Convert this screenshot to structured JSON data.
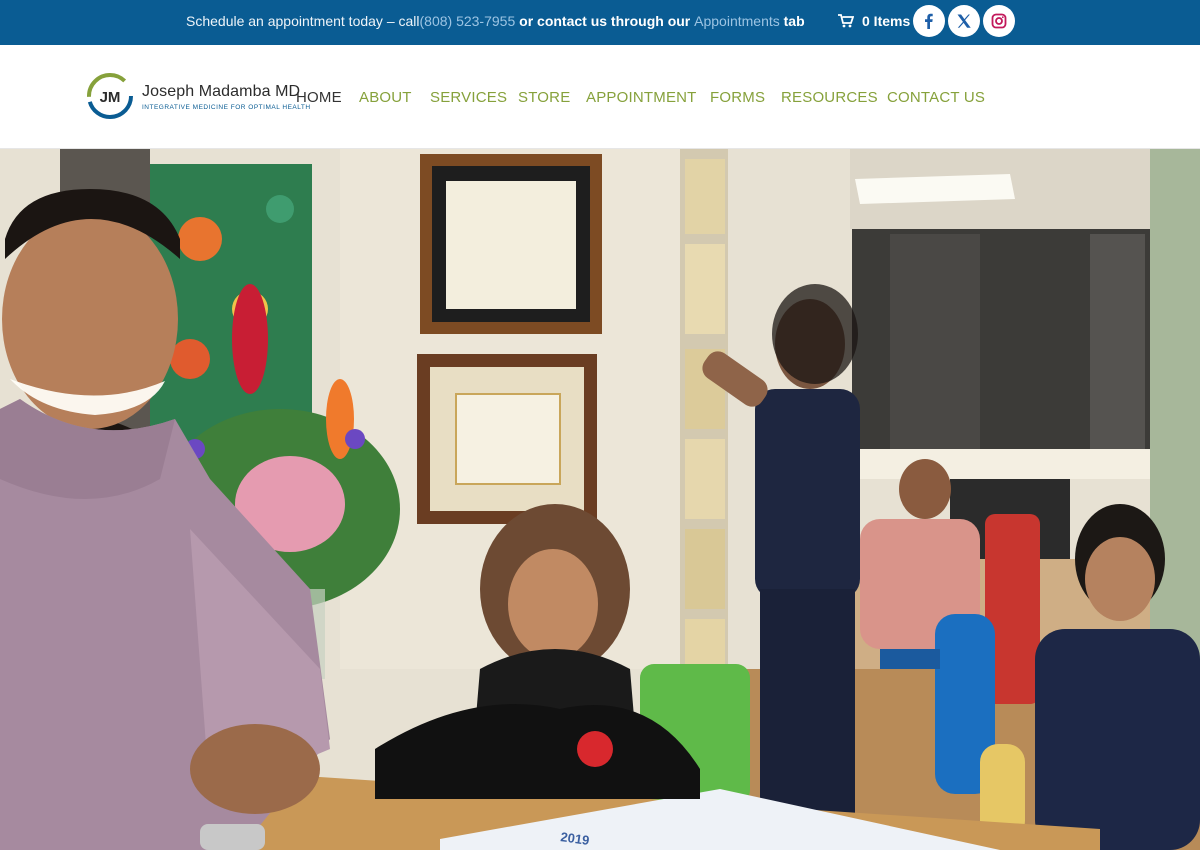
{
  "topbar": {
    "msg_prefix": "Schedule an appointment today – call",
    "phone": "(808) 523-7955",
    "msg_middle": " or contact us through our ",
    "appointments_link": "Appointments",
    "msg_suffix": " tab",
    "cart_label": "0 Items",
    "social": [
      {
        "name": "facebook",
        "icon": "facebook-icon"
      },
      {
        "name": "x",
        "icon": "x-icon"
      },
      {
        "name": "instagram",
        "icon": "instagram-icon"
      }
    ]
  },
  "header": {
    "logo_monogram": "JM",
    "logo_name": "Joseph Madamba MD",
    "logo_tagline": "INTEGRATIVE MEDICINE FOR OPTIMAL HEALTH",
    "nav": [
      {
        "label": "HOME",
        "active": true
      },
      {
        "label": "ABOUT"
      },
      {
        "label": "SERVICES"
      },
      {
        "label": "STORE"
      },
      {
        "label": "APPOINTMENT"
      },
      {
        "label": "FORMS"
      },
      {
        "label": "RESOURCES"
      },
      {
        "label": "CONTACT US"
      }
    ]
  },
  "hero": {
    "calendar_year": "2019"
  },
  "colors": {
    "topbar": "#0a5c93",
    "nav_link": "#86a13b",
    "nav_active": "#333333",
    "link_light": "#9cc4e3"
  }
}
